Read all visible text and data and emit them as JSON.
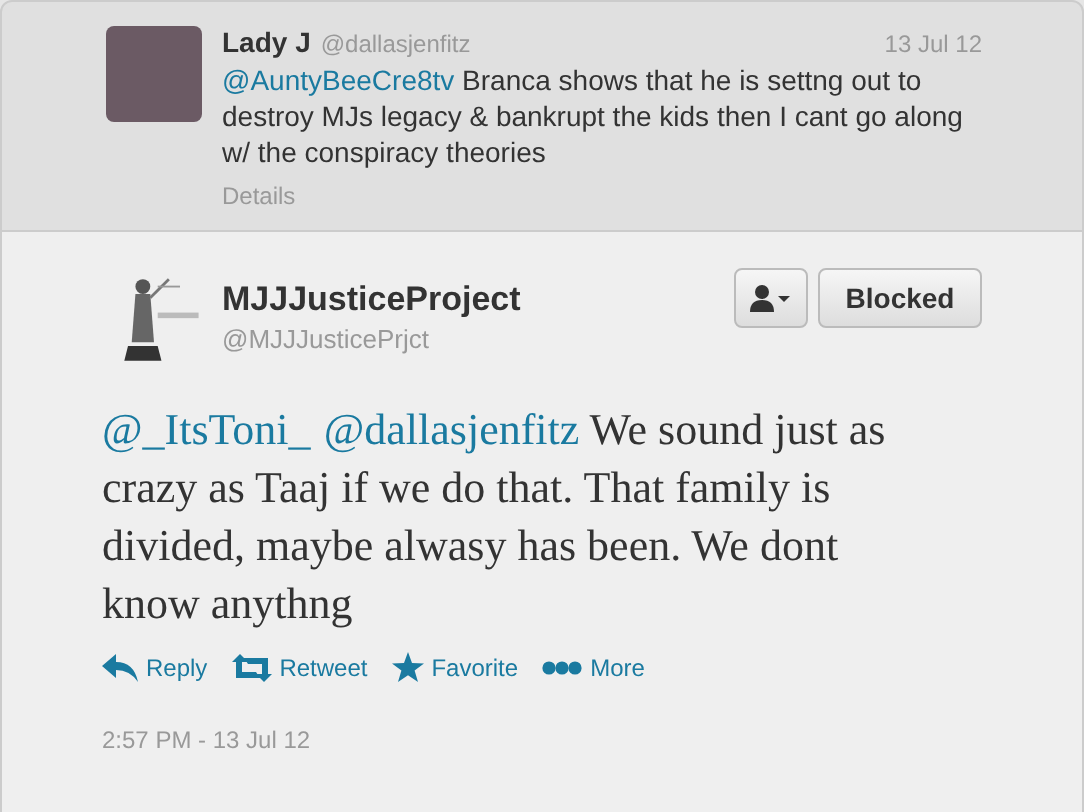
{
  "context_tweet": {
    "name": "Lady J",
    "handle": "@dallasjenfitz",
    "date": "13 Jul 12",
    "segments": [
      {
        "kind": "mention",
        "text": "@AuntyBeeCre8tv"
      },
      {
        "kind": "text",
        "text": " Branca shows that he is settng out to destroy MJs legacy & bankrupt the kids then I cant go along w/ the conspiracy theories"
      }
    ],
    "details": "Details"
  },
  "main_tweet": {
    "name": "MJJJusticeProject",
    "handle": "@MJJJusticePrjct",
    "blocked_button": "Blocked",
    "segments": [
      {
        "kind": "mention",
        "text": "@_ItsToni_"
      },
      {
        "kind": "mention",
        "text": "@dallasjenfitz"
      },
      {
        "kind": "text",
        "text": "  We sound just as crazy as Taaj if we do that. That family is divided, maybe alwasy has been. We dont know anythng"
      }
    ],
    "actions": [
      {
        "kind": "reply",
        "label": "Reply"
      },
      {
        "kind": "retweet",
        "label": "Retweet"
      },
      {
        "kind": "favorite",
        "label": "Favorite"
      },
      {
        "kind": "more",
        "label": "More"
      }
    ],
    "timestamp": "2:57 PM - 13 Jul 12"
  }
}
